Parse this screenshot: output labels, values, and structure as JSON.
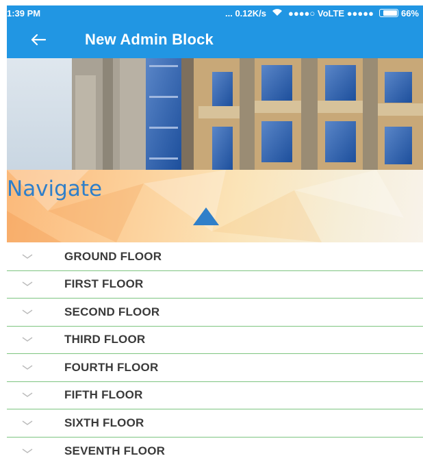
{
  "status_bar": {
    "time": "1:39 PM",
    "indicators": "... 0.12K/s",
    "signal_text": "●●●●○ VoLTE ●●●●●",
    "battery": "66%"
  },
  "app_bar": {
    "back_icon": "arrow-left-icon",
    "title": "New Admin Block"
  },
  "navigate": {
    "title": "Navigate",
    "arrow_icon": "triangle-up-icon",
    "accent_color": "#2f7fc9"
  },
  "floors": [
    {
      "label": "GROUND FLOOR"
    },
    {
      "label": "FIRST FLOOR"
    },
    {
      "label": "SECOND FLOOR"
    },
    {
      "label": "THIRD FLOOR"
    },
    {
      "label": "FOURTH FLOOR"
    },
    {
      "label": "FIFTH FLOOR"
    },
    {
      "label": "SIXTH FLOOR"
    },
    {
      "label": "SEVENTH FLOOR"
    }
  ],
  "colors": {
    "primary": "#2196e3",
    "divider": "#7cc47f"
  }
}
